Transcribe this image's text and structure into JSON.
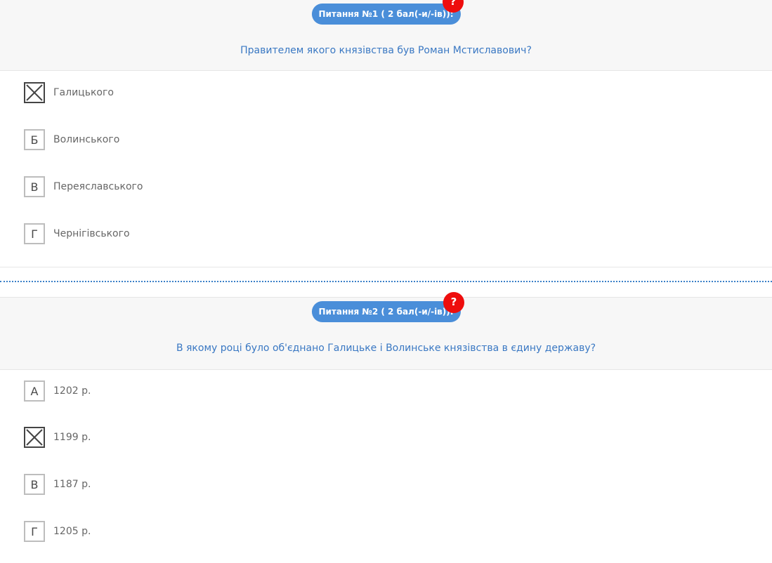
{
  "questions": [
    {
      "badge": "Питання №1 ( 2 бал(-и/-ів)):",
      "help": "?",
      "text": "Правителем якого князівства був Роман Мстиславович?",
      "answers": [
        {
          "letter": "А",
          "text": "Галицького",
          "checked": true
        },
        {
          "letter": "Б",
          "text": "Волинського",
          "checked": false
        },
        {
          "letter": "В",
          "text": "Переяславського",
          "checked": false
        },
        {
          "letter": "Г",
          "text": "Чернігівського",
          "checked": false
        }
      ]
    },
    {
      "badge": "Питання №2 ( 2 бал(-и/-ів)):",
      "help": "?",
      "text": "В якому році було об'єднано Галицьке і Волинське князівства в єдину державу?",
      "answers": [
        {
          "letter": "А",
          "text": "1202 р.",
          "checked": false
        },
        {
          "letter": "Б",
          "text": "1199 р.",
          "checked": true
        },
        {
          "letter": "В",
          "text": "1187 р.",
          "checked": false
        },
        {
          "letter": "Г",
          "text": "1205 р.",
          "checked": false
        }
      ]
    }
  ],
  "colors": {
    "badge": "#4a8ed9",
    "help": "#ee0d0d",
    "question_text": "#3a78c3",
    "divider": "#3a7fc8"
  }
}
